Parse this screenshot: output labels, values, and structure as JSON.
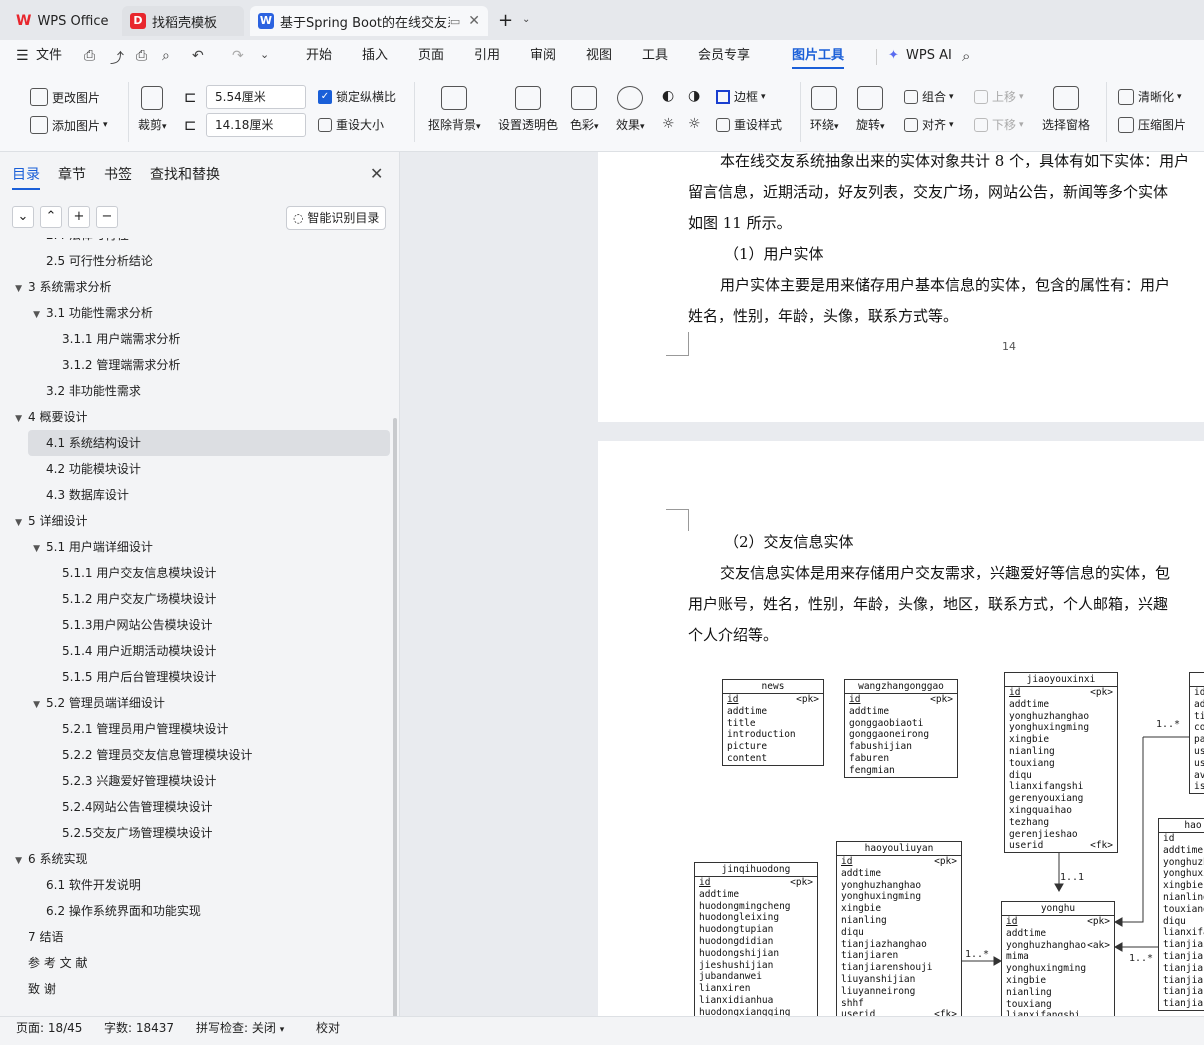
{
  "tabs": [
    {
      "label": "WPS Office",
      "icon": "wps-logo-icon"
    },
    {
      "label": "找稻壳模板",
      "icon": "docer-icon"
    },
    {
      "label": "基于Spring Boot的在线交友系",
      "icon": "word-doc-icon"
    }
  ],
  "menu": {
    "file": "文件",
    "items": [
      "开始",
      "插入",
      "页面",
      "引用",
      "审阅",
      "视图",
      "工具",
      "会员专享",
      "图片工具"
    ],
    "wps_ai": "WPS AI"
  },
  "ribbon": {
    "change_image": "更改图片",
    "add_image": "添加图片",
    "crop": "裁剪",
    "width_value": "5.54厘米",
    "height_value": "14.18厘米",
    "lock_ratio": "锁定纵横比",
    "resize": "重设大小",
    "remove_bg": "抠除背景",
    "set_transparent": "设置透明色",
    "color": "色彩",
    "effects": "效果",
    "border": "边框",
    "reset_style": "重设样式",
    "wrap": "环绕",
    "rotate": "旋转",
    "group": "组合",
    "align": "对齐",
    "move_up": "上移",
    "move_down": "下移",
    "selection_pane": "选择窗格",
    "sharpen": "清晰化",
    "compress": "压缩图片"
  },
  "sidebar": {
    "tabs": [
      "目录",
      "章节",
      "书签",
      "查找和替换"
    ],
    "smart_toc": "智能识别目录",
    "toc": [
      {
        "label": "2.4  法律可行性",
        "level": 2,
        "arrow": ""
      },
      {
        "label": "2.5  可行性分析结论",
        "level": 2,
        "arrow": ""
      },
      {
        "label": "3   系统需求分析",
        "level": 1,
        "arrow": "▼"
      },
      {
        "label": "3.1  功能性需求分析",
        "level": 2,
        "arrow": "▼"
      },
      {
        "label": "3.1.1  用户端需求分析",
        "level": 3,
        "arrow": ""
      },
      {
        "label": "3.1.2  管理端需求分析",
        "level": 3,
        "arrow": ""
      },
      {
        "label": "3.2  非功能性需求",
        "level": 2,
        "arrow": ""
      },
      {
        "label": "4   概要设计",
        "level": 1,
        "arrow": "▼"
      },
      {
        "label": "4.1  系统结构设计",
        "level": 2,
        "arrow": "",
        "selected": true
      },
      {
        "label": "4.2  功能模块设计",
        "level": 2,
        "arrow": ""
      },
      {
        "label": "4.3  数据库设计",
        "level": 2,
        "arrow": ""
      },
      {
        "label": "5   详细设计",
        "level": 1,
        "arrow": "▼"
      },
      {
        "label": "5.1  用户端详细设计",
        "level": 2,
        "arrow": "▼"
      },
      {
        "label": "5.1.1  用户交友信息模块设计",
        "level": 3,
        "arrow": ""
      },
      {
        "label": "5.1.2  用户交友广场模块设计",
        "level": 3,
        "arrow": ""
      },
      {
        "label": "5.1.3用户网站公告模块设计",
        "level": 3,
        "arrow": ""
      },
      {
        "label": "5.1.4  用户近期活动模块设计",
        "level": 3,
        "arrow": ""
      },
      {
        "label": "5.1.5  用户后台管理模块设计",
        "level": 3,
        "arrow": ""
      },
      {
        "label": "5.2  管理员端详细设计",
        "level": 2,
        "arrow": "▼"
      },
      {
        "label": "5.2.1  管理员用户管理模块设计",
        "level": 3,
        "arrow": ""
      },
      {
        "label": "5.2.2  管理员交友信息管理模块设计",
        "level": 3,
        "arrow": ""
      },
      {
        "label": "5.2.3  兴趣爱好管理模块设计",
        "level": 3,
        "arrow": ""
      },
      {
        "label": "5.2.4网站公告管理模块设计",
        "level": 3,
        "arrow": ""
      },
      {
        "label": "5.2.5交友广场管理模块设计",
        "level": 3,
        "arrow": ""
      },
      {
        "label": "6   系统实现",
        "level": 1,
        "arrow": "▼"
      },
      {
        "label": "6.1  软件开发说明",
        "level": 2,
        "arrow": ""
      },
      {
        "label": "6.2  操作系统界面和功能实现",
        "level": 2,
        "arrow": ""
      },
      {
        "label": "7   结语",
        "level": 1,
        "arrow": ""
      },
      {
        "label": "参  考  文  献",
        "level": 1,
        "arrow": ""
      },
      {
        "label": "致        谢",
        "level": 1,
        "arrow": ""
      }
    ]
  },
  "document": {
    "page1_lines": [
      "本在线交友系统抽象出来的实体对象共计 8 个，具体有如下实体：用户",
      "留言信息，近期活动，好友列表，交友广场，网站公告，新闻等多个实体",
      "如图 11 所示。",
      "（1）用户实体",
      "用户实体主要是用来储存用户基本信息的实体，包含的属性有：用户",
      "姓名，性别，年龄，头像，联系方式等。"
    ],
    "page_number": "14",
    "page2_lines": [
      "（2）交友信息实体",
      "交友信息实体是用来存储用户交友需求，兴趣爱好等信息的实体，包",
      "用户账号，姓名，性别，年龄，头像，地区，联系方式，个人邮箱，兴趣",
      "个人介绍等。"
    ]
  },
  "er": {
    "entities": [
      {
        "name": "news",
        "rows": [
          [
            "id",
            "<pk>"
          ],
          [
            "addtime",
            ""
          ],
          [
            "title",
            ""
          ],
          [
            "introduction",
            ""
          ],
          [
            "picture",
            ""
          ],
          [
            "content",
            ""
          ]
        ]
      },
      {
        "name": "wangzhangonggao",
        "rows": [
          [
            "id",
            "<pk>"
          ],
          [
            "addtime",
            ""
          ],
          [
            "gonggaobiaoti",
            ""
          ],
          [
            "gonggaoneirong",
            ""
          ],
          [
            "fabushijian",
            ""
          ],
          [
            "faburen",
            ""
          ],
          [
            "fengmian",
            ""
          ]
        ]
      },
      {
        "name": "jiaoyouxinxi",
        "rows": [
          [
            "id",
            "<pk>"
          ],
          [
            "addtime",
            ""
          ],
          [
            "yonghuzhanghao",
            ""
          ],
          [
            "yonghuxingming",
            ""
          ],
          [
            "xingbie",
            ""
          ],
          [
            "nianling",
            ""
          ],
          [
            "touxiang",
            ""
          ],
          [
            "diqu",
            ""
          ],
          [
            "lianxifangshi",
            ""
          ],
          [
            "gerenyouxiang",
            ""
          ],
          [
            "xingquaihao",
            ""
          ],
          [
            "tezhang",
            ""
          ],
          [
            "gerenjieshao",
            ""
          ],
          [
            "userid",
            "<fk>"
          ]
        ]
      },
      {
        "name": "jinqihuodong",
        "rows": [
          [
            "id",
            "<pk>"
          ],
          [
            "addtime",
            ""
          ],
          [
            "huodongmingcheng",
            ""
          ],
          [
            "huodongleixing",
            ""
          ],
          [
            "huodongtupian",
            ""
          ],
          [
            "huodongdidian",
            ""
          ],
          [
            "huodongshijian",
            ""
          ],
          [
            "jieshushijian",
            ""
          ],
          [
            "jubandanwei",
            ""
          ],
          [
            "lianxiren",
            ""
          ],
          [
            "lianxidianhua",
            ""
          ],
          [
            "huodongxiangqing",
            ""
          ]
        ]
      },
      {
        "name": "haoyouliuyan",
        "rows": [
          [
            "id",
            "<pk>"
          ],
          [
            "addtime",
            ""
          ],
          [
            "yonghuzhanghao",
            ""
          ],
          [
            "yonghuxingming",
            ""
          ],
          [
            "xingbie",
            ""
          ],
          [
            "nianling",
            ""
          ],
          [
            "diqu",
            ""
          ],
          [
            "tianjiazhanghao",
            ""
          ],
          [
            "tianjiaren",
            ""
          ],
          [
            "tianjiarenshouji",
            ""
          ],
          [
            "liuyanshijian",
            ""
          ],
          [
            "liuyanneirong",
            ""
          ],
          [
            "shhf",
            ""
          ],
          [
            "userid",
            "<fk>"
          ]
        ]
      },
      {
        "name": "yonghu",
        "rows": [
          [
            "id",
            "<pk>"
          ],
          [
            "addtime",
            ""
          ],
          [
            "yonghuzhanghao",
            "<ak>"
          ],
          [
            "mima",
            ""
          ],
          [
            "yonghuxingming",
            ""
          ],
          [
            "xingbie",
            ""
          ],
          [
            "nianling",
            ""
          ],
          [
            "touxiang",
            ""
          ],
          [
            "lianxifangshi",
            ""
          ]
        ]
      },
      {
        "name": "hao",
        "rows": [
          [
            "id",
            ""
          ],
          [
            "addtime",
            ""
          ],
          [
            "yonghuzh",
            ""
          ],
          [
            "yonghuxi",
            ""
          ],
          [
            "xingbie",
            ""
          ],
          [
            "nianling",
            ""
          ],
          [
            "touxiang",
            ""
          ],
          [
            "diqu",
            ""
          ],
          [
            "lianxifa",
            ""
          ],
          [
            "tianjiaz",
            ""
          ],
          [
            "tianjiar",
            ""
          ],
          [
            "tianjiar",
            ""
          ],
          [
            "tianjiar",
            ""
          ],
          [
            "tianjiar",
            ""
          ],
          [
            "tianjias",
            ""
          ]
        ]
      },
      {
        "name": "",
        "rows": [
          [
            "id",
            ""
          ],
          [
            "ad",
            ""
          ],
          [
            "ti",
            ""
          ],
          [
            "co",
            ""
          ],
          [
            "pa",
            ""
          ],
          [
            "us",
            ""
          ],
          [
            "us",
            ""
          ],
          [
            "av",
            ""
          ],
          [
            "is",
            ""
          ]
        ]
      }
    ],
    "labels": [
      "1..*",
      "1..1",
      "1..*",
      "1..*"
    ]
  },
  "status": {
    "page": "页面: 18/45",
    "words": "字数: 18437",
    "spell": "拼写检查: 关闭",
    "proof": "校对"
  }
}
